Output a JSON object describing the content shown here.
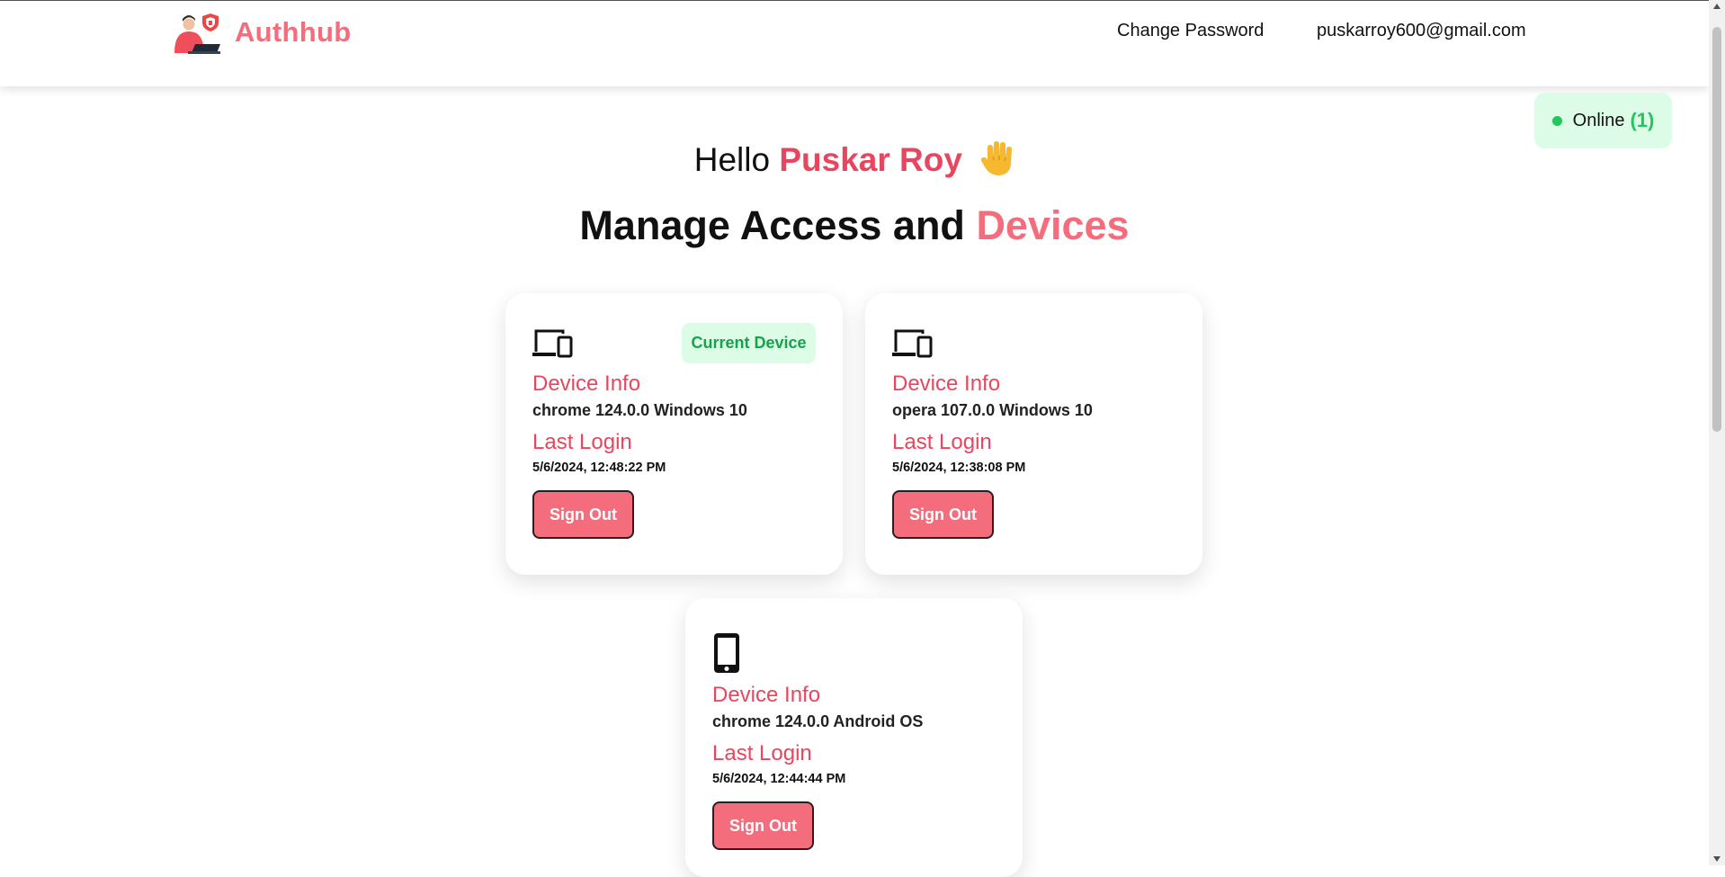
{
  "nav": {
    "brand": "Authhub",
    "brand_icon": "person-with-laptop-shield-logo",
    "change_password": "Change Password",
    "email": "puskarroy600@gmail.com"
  },
  "status": {
    "label": "Online",
    "count": "(1)",
    "color": "#22c55e"
  },
  "greeting": {
    "prefix": "Hello",
    "name": "Puskar Roy",
    "emoji_icon": "waving-hand-icon"
  },
  "heading": {
    "main": "Manage Access and",
    "accent": "Devices"
  },
  "colors": {
    "accent": "#f46d7d",
    "accent_dark": "#e8455f",
    "success": "#16a34a",
    "success_bg": "#dcfce7"
  },
  "devices": [
    {
      "icon": "devices-icon",
      "badge": "Current Device",
      "info_label": "Device Info",
      "info": "chrome 124.0.0 Windows 10",
      "login_label": "Last Login",
      "last_login": "5/6/2024, 12:48:22 PM",
      "button": "Sign Out"
    },
    {
      "icon": "devices-icon",
      "info_label": "Device Info",
      "info": "opera 107.0.0 Windows 10",
      "login_label": "Last Login",
      "last_login": "5/6/2024, 12:38:08 PM",
      "button": "Sign Out"
    },
    {
      "icon": "smartphone-icon",
      "info_label": "Device Info",
      "info": "chrome 124.0.0 Android OS",
      "login_label": "Last Login",
      "last_login": "5/6/2024, 12:44:44 PM",
      "button": "Sign Out"
    }
  ]
}
